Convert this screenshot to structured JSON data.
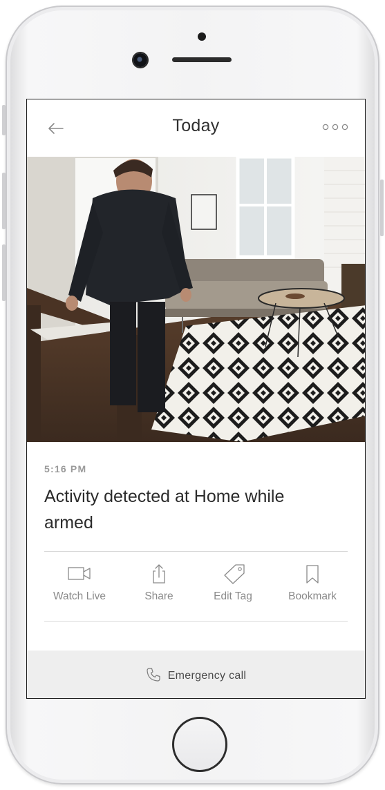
{
  "header": {
    "title": "Today",
    "back_icon": "arrow-left-icon",
    "more_icon": "more-horizontal-icon"
  },
  "event": {
    "time": "5:16 PM",
    "title": "Activity detected at Home while armed"
  },
  "actions": [
    {
      "label": "Watch Live",
      "icon": "video-camera-icon"
    },
    {
      "label": "Share",
      "icon": "share-icon"
    },
    {
      "label": "Edit Tag",
      "icon": "tag-icon"
    },
    {
      "label": "Bookmark",
      "icon": "bookmark-icon"
    }
  ],
  "emergency": {
    "label": "Emergency call",
    "icon": "phone-icon"
  },
  "colors": {
    "text_primary": "#2b2b2b",
    "text_muted": "#8a8a8a",
    "emergency_bg": "#eeeeee",
    "divider": "#d8d8d8"
  }
}
